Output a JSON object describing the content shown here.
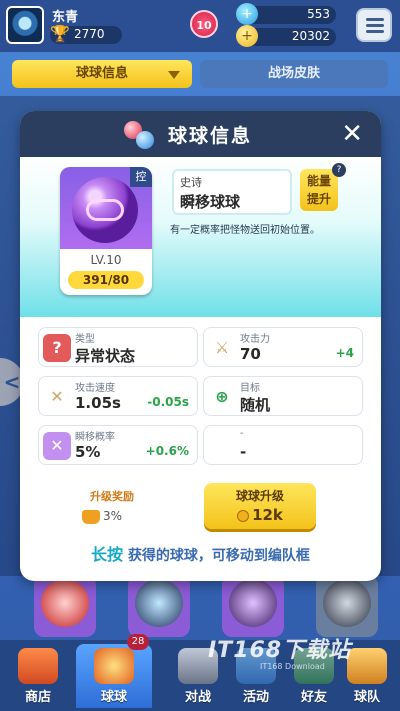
{
  "player": {
    "name": "东青",
    "trophies": "2770",
    "level": "10"
  },
  "resources": {
    "gems": "553",
    "coins": "20302"
  },
  "top_tabs": {
    "ball_info": "球球信息",
    "battle_skin": "战场皮肤"
  },
  "modal": {
    "title": "球球信息",
    "close": "✕",
    "card": {
      "tag": "控",
      "level": "LV.10",
      "progress": "391/80"
    },
    "rarity": "史诗",
    "ball_name": "瞬移球球",
    "boost_button": "能量\n提升",
    "help": "?",
    "description": "有一定概率把怪物送回初始位置。",
    "stats": [
      {
        "label": "类型",
        "value": "异常状态",
        "delta": "",
        "icon": "question-icon"
      },
      {
        "label": "攻击力",
        "value": "70",
        "delta": "+4",
        "icon": "sword-icon"
      },
      {
        "label": "攻击速度",
        "value": "1.05s",
        "delta": "-0.05s",
        "icon": "crossed-swords-icon"
      },
      {
        "label": "目标",
        "value": "随机",
        "delta": "",
        "icon": "crosshair-icon"
      },
      {
        "label": "瞬移概率",
        "value": "5%",
        "delta": "+0.6%",
        "icon": "teleport-arrows-icon"
      },
      {
        "label": "-",
        "value": "-",
        "delta": "",
        "icon": ""
      }
    ],
    "reward": {
      "label": "升级奖励",
      "value": "3%"
    },
    "upgrade": {
      "label": "球球升级",
      "cost": "12k"
    },
    "hint": {
      "highlight": "长按",
      "text": "获得的球球，可移动到编队框"
    }
  },
  "nav": {
    "shop": "商店",
    "ball": "球球",
    "battle": "对战",
    "events": "活动",
    "friends": "好友",
    "team": "球队",
    "ball_badge": "28"
  },
  "watermark": {
    "big": "IT168下载站",
    "small": "IT168 Download"
  },
  "colors": {
    "header": "#2c3e60",
    "accent_yellow": "#f3c21a",
    "positive": "#2aa44a",
    "hero_cyan": "#6fe0e8"
  }
}
